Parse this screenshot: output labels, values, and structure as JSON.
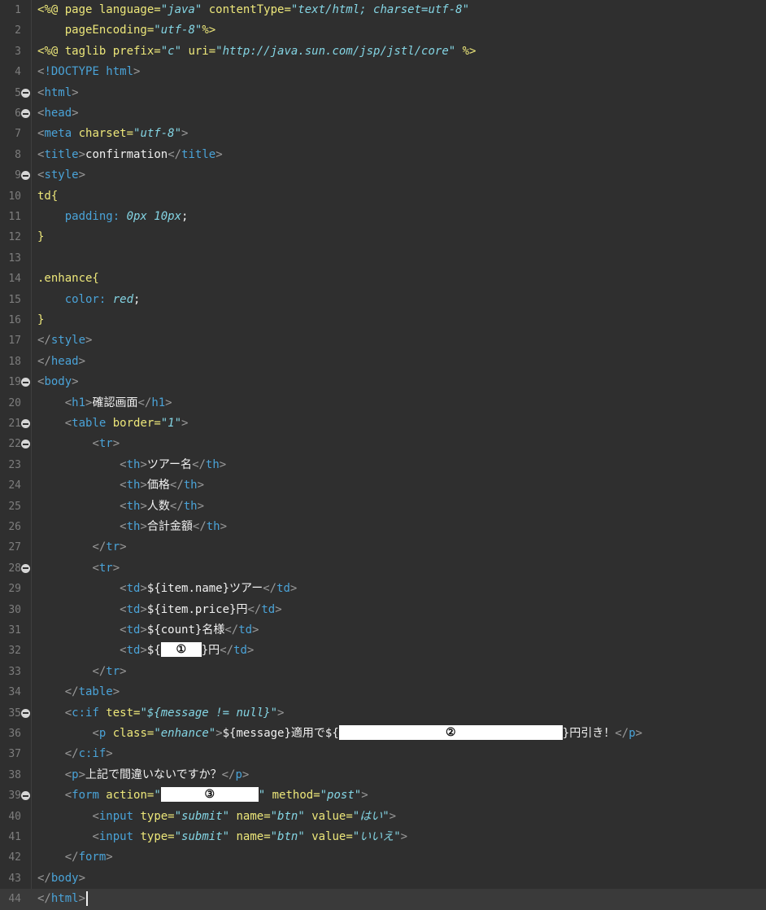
{
  "editor": {
    "lines": [
      {
        "n": "1",
        "fold": false
      },
      {
        "n": "2",
        "fold": false
      },
      {
        "n": "3",
        "fold": false
      },
      {
        "n": "4",
        "fold": false
      },
      {
        "n": "5",
        "fold": true
      },
      {
        "n": "6",
        "fold": true
      },
      {
        "n": "7",
        "fold": false
      },
      {
        "n": "8",
        "fold": false
      },
      {
        "n": "9",
        "fold": true
      },
      {
        "n": "10",
        "fold": false
      },
      {
        "n": "11",
        "fold": false
      },
      {
        "n": "12",
        "fold": false
      },
      {
        "n": "13",
        "fold": false
      },
      {
        "n": "14",
        "fold": false
      },
      {
        "n": "15",
        "fold": false
      },
      {
        "n": "16",
        "fold": false
      },
      {
        "n": "17",
        "fold": false
      },
      {
        "n": "18",
        "fold": false
      },
      {
        "n": "19",
        "fold": true
      },
      {
        "n": "20",
        "fold": false
      },
      {
        "n": "21",
        "fold": true
      },
      {
        "n": "22",
        "fold": true
      },
      {
        "n": "23",
        "fold": false
      },
      {
        "n": "24",
        "fold": false
      },
      {
        "n": "25",
        "fold": false
      },
      {
        "n": "26",
        "fold": false
      },
      {
        "n": "27",
        "fold": false
      },
      {
        "n": "28",
        "fold": true
      },
      {
        "n": "29",
        "fold": false
      },
      {
        "n": "30",
        "fold": false
      },
      {
        "n": "31",
        "fold": false
      },
      {
        "n": "32",
        "fold": false
      },
      {
        "n": "33",
        "fold": false
      },
      {
        "n": "34",
        "fold": false
      },
      {
        "n": "35",
        "fold": true
      },
      {
        "n": "36",
        "fold": false
      },
      {
        "n": "37",
        "fold": false
      },
      {
        "n": "38",
        "fold": false
      },
      {
        "n": "39",
        "fold": true
      },
      {
        "n": "40",
        "fold": false
      },
      {
        "n": "41",
        "fold": false
      },
      {
        "n": "42",
        "fold": false
      },
      {
        "n": "43",
        "fold": false
      },
      {
        "n": "44",
        "fold": false
      }
    ],
    "t": {
      "l1a": "<%@ page language=",
      "l1b": "\"java\"",
      "l1c": " contentType=",
      "l1d": "\"text/html; charset=utf-8\"",
      "l2a": "    pageEncoding=",
      "l2b": "\"utf-8\"",
      "l2c": "%>",
      "l3a": "<%@ taglib prefix=",
      "l3b": "\"c\"",
      "l3c": " uri=",
      "l3d": "\"http://java.sun.com/jsp/jstl/core\"",
      "l3e": " %>",
      "lt": "<",
      "gt": ">",
      "lts": "</",
      "doctype": "!DOCTYPE html",
      "html": "html",
      "head": "head",
      "meta": "meta",
      "charset_attr": " charset=",
      "charset_val": "\"utf-8\"",
      "title": "title",
      "title_text": "confirmation",
      "style": "style",
      "td_sel": "td{",
      "padding_prop": "    padding: ",
      "padding_val": "0px 10px",
      "semicolon": ";",
      "close_brace": "}",
      "enhance_sel": ".enhance{",
      "color_prop": "    color: ",
      "color_val": "red",
      "body": "body",
      "h1": "h1",
      "h1_text": "確認画面",
      "table": "table",
      "border_attr": " border=",
      "border_val": "\"1\"",
      "tr": "tr",
      "th": "th",
      "th1": "ツアー名",
      "th2": "価格",
      "th3": "人数",
      "th4": "合計金額",
      "td": "td",
      "td1": "${item.name}ツアー",
      "td2": "${item.price}円",
      "td3": "${count}名様",
      "td4a": "${",
      "td4b": "}円",
      "blank1": "①",
      "cif": "c:if",
      "test_attr": " test=",
      "test_val": "\"${message != null}\"",
      "p": "p",
      "class_attr": " class=",
      "class_val": "\"enhance\"",
      "p1a": "${message}適用で${",
      "p1b": "}円引き！",
      "blank2": "②",
      "p2": "上記で間違いないですか？",
      "form": "form",
      "action_attr": " action=",
      "action_q1": "\"",
      "action_q2": "\"",
      "blank3": "③",
      "method_attr": " method=",
      "method_val": "\"post\"",
      "input": "input",
      "type_attr": " type=",
      "type_val": "\"submit\"",
      "name_attr": " name=",
      "name_val": "\"btn\"",
      "value_attr": " value=",
      "value_yes": "\"はい\"",
      "value_no": "\"いいえ\""
    }
  }
}
